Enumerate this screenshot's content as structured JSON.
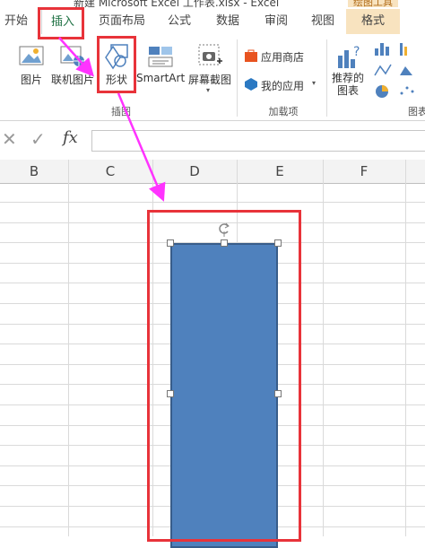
{
  "window": {
    "title": "新建 Microsoft Excel 工作表.xlsx - Excel",
    "context_group": "绘图工具"
  },
  "tabs": [
    "开始",
    "插入",
    "页面布局",
    "公式",
    "数据",
    "审阅",
    "视图",
    "格式"
  ],
  "ribbon": {
    "illustrations": {
      "picture": "图片",
      "online_picture": "联机图片",
      "shapes": "形状",
      "smartart": "SmartArt",
      "screenshot": "屏幕截图",
      "group_label": "插图"
    },
    "addins": {
      "store": "应用商店",
      "my_apps": "我的应用",
      "group_label": "加载项"
    },
    "charts": {
      "recommended": [
        "推荐的",
        "图表"
      ],
      "group_label": "图表"
    }
  },
  "formula_bar": {
    "fx": "fx",
    "value": ""
  },
  "columns": [
    "B",
    "C",
    "D",
    "E",
    "F"
  ],
  "colors": {
    "accent_red": "#e8333a",
    "arrow_magenta": "#ff33ff",
    "shape_fill": "#4f81bd",
    "excel_green": "#217346"
  }
}
